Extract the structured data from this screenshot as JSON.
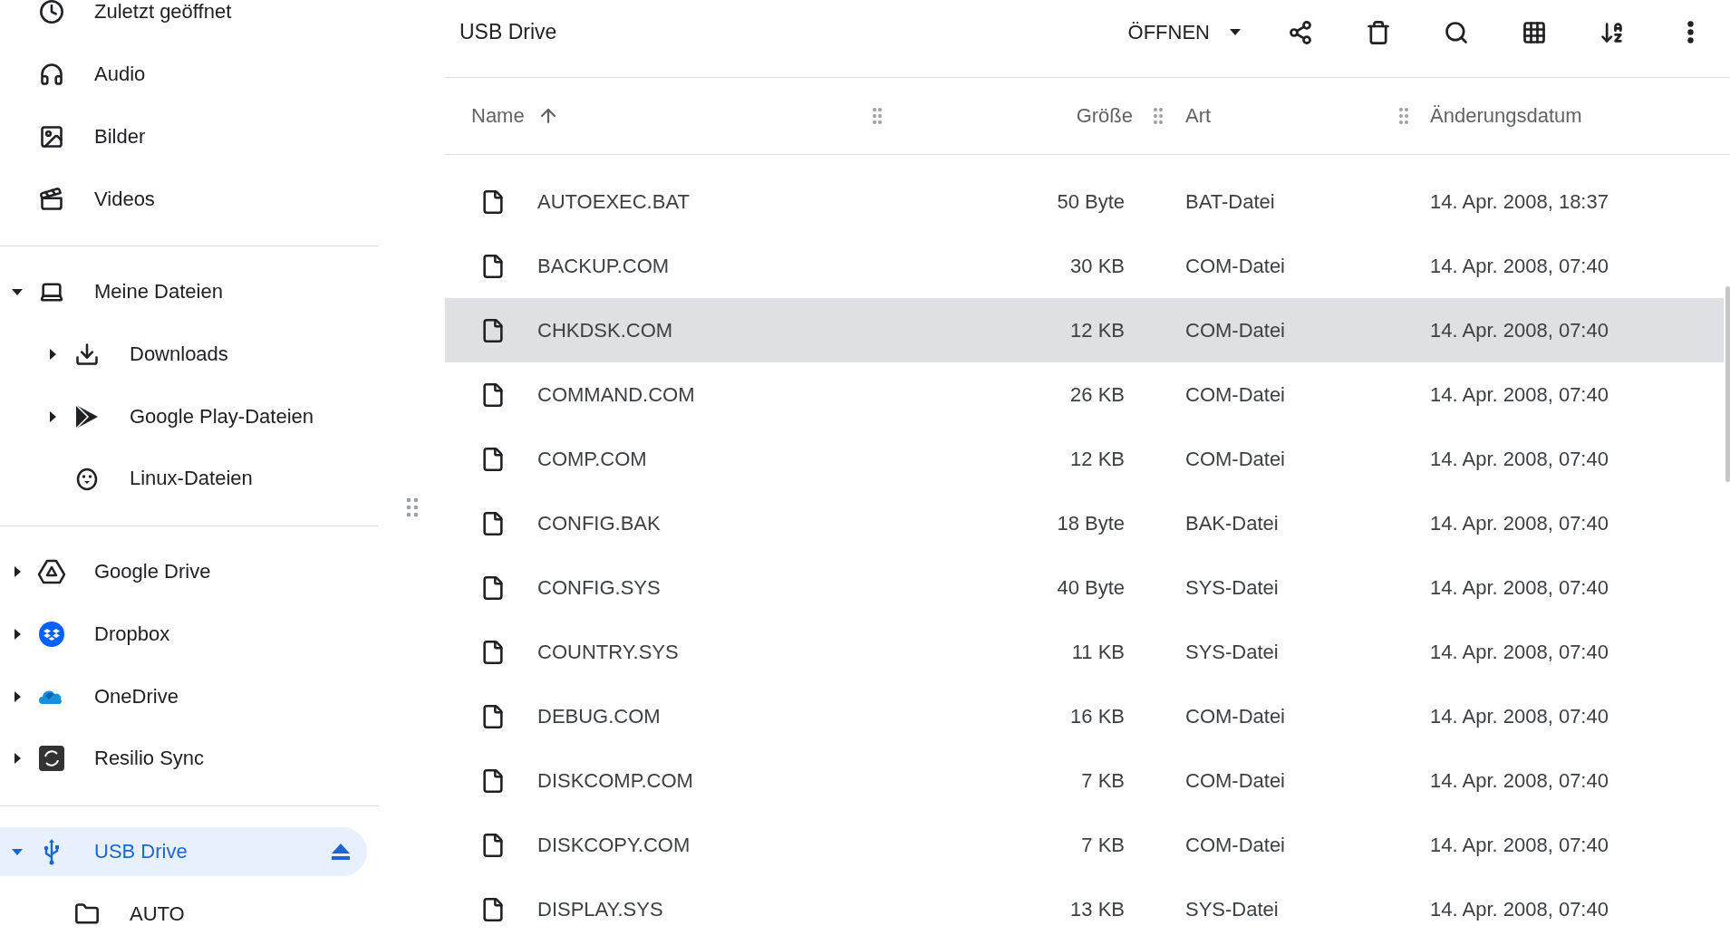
{
  "sidebar": {
    "sections": [
      {
        "items": [
          {
            "label": "Zuletzt geöffnet",
            "selected": false
          },
          {
            "label": "Audio",
            "selected": false
          },
          {
            "label": "Bilder",
            "selected": false
          },
          {
            "label": "Videos",
            "selected": false
          }
        ]
      },
      {
        "items": [
          {
            "label": "Meine Dateien",
            "selected": false,
            "expanded": true,
            "children": [
              {
                "label": "Downloads",
                "selected": false,
                "expanded": false
              },
              {
                "label": "Google Play-Dateien",
                "selected": false,
                "expanded": false
              },
              {
                "label": "Linux-Dateien",
                "selected": false
              }
            ]
          }
        ]
      },
      {
        "items": [
          {
            "label": "Google Drive",
            "selected": false,
            "expanded": false
          },
          {
            "label": "Dropbox",
            "selected": false,
            "expanded": false
          },
          {
            "label": "OneDrive",
            "selected": false,
            "expanded": false
          },
          {
            "label": "Resilio Sync",
            "selected": false,
            "expanded": false
          }
        ]
      },
      {
        "items": [
          {
            "label": "USB Drive",
            "selected": true,
            "expanded": true,
            "eject": true,
            "children": [
              {
                "label": "AUTO",
                "selected": false
              }
            ]
          }
        ]
      }
    ]
  },
  "toolbar": {
    "title": "USB Drive",
    "open_button": "ÖFFNEN"
  },
  "table": {
    "columns": [
      {
        "label": "Name",
        "sorted": true
      },
      {
        "label": "Größe",
        "sorted": false
      },
      {
        "label": "Art",
        "sorted": false
      },
      {
        "label": "Änderungsdatum",
        "sorted": false
      }
    ],
    "rows": [
      {
        "name": "AUTOEXEC.BAT",
        "size": "50 Byte",
        "type": "BAT-Datei",
        "date": "14. Apr. 2008, 18:37",
        "selected": false
      },
      {
        "name": "BACKUP.COM",
        "size": "30 KB",
        "type": "COM-Datei",
        "date": "14. Apr. 2008, 07:40",
        "selected": false
      },
      {
        "name": "CHKDSK.COM",
        "size": "12 KB",
        "type": "COM-Datei",
        "date": "14. Apr. 2008, 07:40",
        "selected": true
      },
      {
        "name": "COMMAND.COM",
        "size": "26 KB",
        "type": "COM-Datei",
        "date": "14. Apr. 2008, 07:40",
        "selected": false
      },
      {
        "name": "COMP.COM",
        "size": "12 KB",
        "type": "COM-Datei",
        "date": "14. Apr. 2008, 07:40",
        "selected": false
      },
      {
        "name": "CONFIG.BAK",
        "size": "18 Byte",
        "type": "BAK-Datei",
        "date": "14. Apr. 2008, 07:40",
        "selected": false
      },
      {
        "name": "CONFIG.SYS",
        "size": "40 Byte",
        "type": "SYS-Datei",
        "date": "14. Apr. 2008, 07:40",
        "selected": false
      },
      {
        "name": "COUNTRY.SYS",
        "size": "11 KB",
        "type": "SYS-Datei",
        "date": "14. Apr. 2008, 07:40",
        "selected": false
      },
      {
        "name": "DEBUG.COM",
        "size": "16 KB",
        "type": "COM-Datei",
        "date": "14. Apr. 2008, 07:40",
        "selected": false
      },
      {
        "name": "DISKCOMP.COM",
        "size": "7 KB",
        "type": "COM-Datei",
        "date": "14. Apr. 2008, 07:40",
        "selected": false
      },
      {
        "name": "DISKCOPY.COM",
        "size": "7 KB",
        "type": "COM-Datei",
        "date": "14. Apr. 2008, 07:40",
        "selected": false
      },
      {
        "name": "DISPLAY.SYS",
        "size": "13 KB",
        "type": "SYS-Datei",
        "date": "14. Apr. 2008, 07:40",
        "selected": false
      }
    ]
  }
}
